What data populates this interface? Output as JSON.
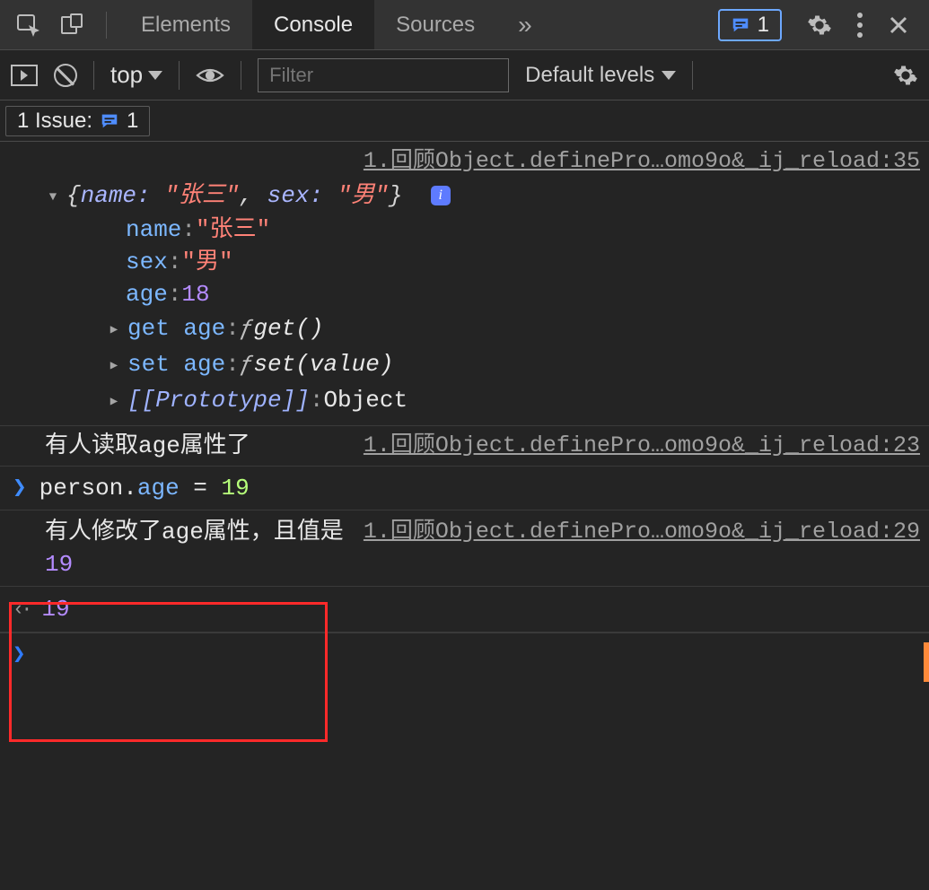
{
  "tabs": {
    "elements": "Elements",
    "console": "Console",
    "sources": "Sources"
  },
  "badge": {
    "count": "1"
  },
  "toolbar": {
    "context": "top",
    "filter_placeholder": "Filter",
    "levels": "Default levels"
  },
  "issues": {
    "label": "1 Issue:",
    "count": "1"
  },
  "obj_summary": {
    "prefix": "{",
    "k_name": "name:",
    "v_name": "\"张三\"",
    "comma1": ", ",
    "k_sex": "sex:",
    "v_sex": "\"男\"",
    "suffix": "}"
  },
  "obj_props": {
    "name_k": "name",
    "name_v": "\"张三\"",
    "sex_k": "sex",
    "sex_v": "\"男\"",
    "age_k": "age",
    "age_v": "18",
    "get_label": "get age",
    "get_fn": "get()",
    "set_label": "set age",
    "set_fn": "set(value)",
    "proto_label": "[[Prototype]]",
    "proto_val": "Object"
  },
  "links": {
    "l1": "1.回顾Object.definePro…omo9o&_ij_reload:35",
    "l2": "1.回顾Object.definePro…omo9o&_ij_reload:23",
    "l3": "1.回顾Object.definePro…omo9o&_ij_reload:29"
  },
  "logs": {
    "read": "有人读取age属性了",
    "write_pre": "有人修改了age属性，且值是 ",
    "write_val": "19"
  },
  "input": {
    "person": "person",
    "dot": ".",
    "age": "age",
    "eq": " = ",
    "val": "19"
  },
  "output": {
    "val": "19"
  }
}
